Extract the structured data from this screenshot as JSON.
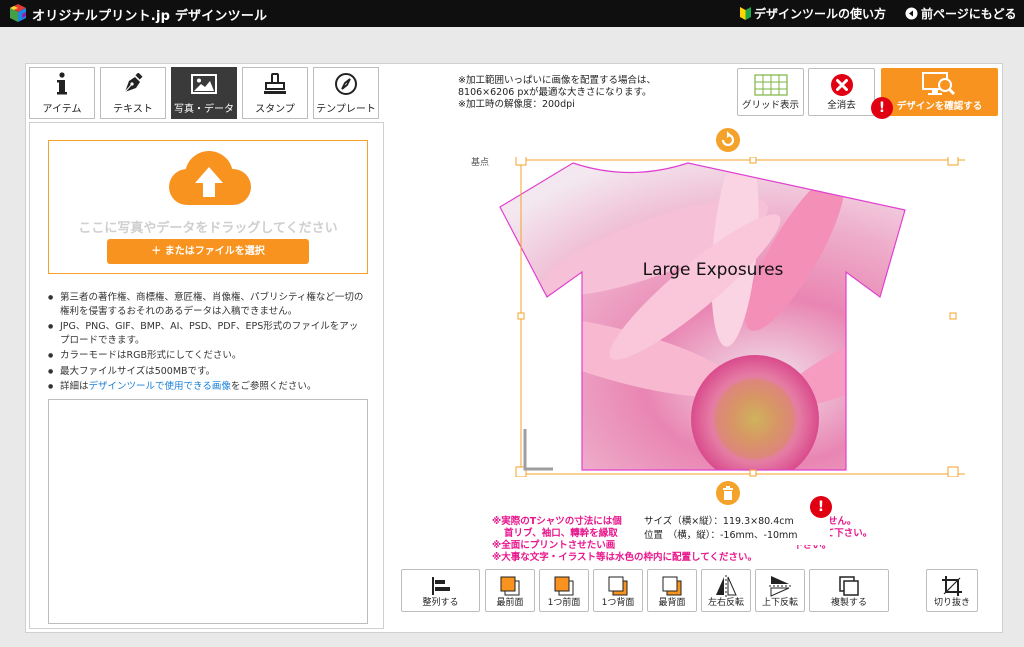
{
  "header": {
    "brand": "オリジナルプリント.jp デザインツール",
    "help_link": "デザインツールの使い方",
    "back_link": "前ページにもどる"
  },
  "tabs": [
    {
      "label": "アイテム",
      "icon": "info-icon"
    },
    {
      "label": "テキスト",
      "icon": "pen-icon"
    },
    {
      "label": "写真・データ",
      "icon": "image-icon",
      "active": true
    },
    {
      "label": "スタンプ",
      "icon": "stamp-icon"
    },
    {
      "label": "テンプレート",
      "icon": "compass-icon"
    }
  ],
  "upload": {
    "drop_text": "ここに写真やデータをドラッグしてください",
    "file_button": "＋ またはファイルを選択"
  },
  "notes": {
    "n1": "第三者の著作権、商標権、意匠権、肖像権、パブリシティ権など一切の権利を侵害するおそれのあるデータは入稿できません。",
    "n2": "JPG、PNG、GIF、BMP、AI、PSD、PDF、EPS形式のファイルをアップロードできます。",
    "n3": "カラーモードはRGB形式にしてください。",
    "n4": "最大ファイルサイズは500MBです。",
    "n5_prefix": "詳細は",
    "n5_link": "デザインツールで使用できる画像",
    "n5_suffix": "をご参照ください。"
  },
  "canvas_note": {
    "line1": "※加工範囲いっぱいに画像を配置する場合は、",
    "line2": "8106×6206 pxが最適な大きさになります。",
    "line3": "※加工時の解像度：200dpi"
  },
  "toolbar": {
    "grid_label": "グリッド表示",
    "clear_label": "全消去",
    "confirm_label": "デザインを確認する"
  },
  "design": {
    "base_label": "基点",
    "text": "Large Exposures"
  },
  "warnings": {
    "w1": "※実際のTシャツの寸法には個",
    "w1b": "出来ません。",
    "w2": "首リブ、袖口、轉幹を縁取",
    "w2b": "避けて下さい。",
    "w3": "※全面にプリントさせたい画",
    "w3b": "下さい。",
    "w4": "※大事な文字・イラスト等は水色の枠内に配置してください。"
  },
  "info": {
    "size": "サイズ（横×縦）：119.3×80.4cm",
    "position": "位置　（横，縦）：-16mm、-10mm"
  },
  "bottom_tools": [
    {
      "label": "整列する",
      "icon": "align-icon"
    },
    {
      "label": "最前面",
      "icon": "bring-front-icon"
    },
    {
      "label": "1つ前面",
      "icon": "bring-forward-icon"
    },
    {
      "label": "1つ背面",
      "icon": "send-backward-icon"
    },
    {
      "label": "最背面",
      "icon": "send-back-icon"
    },
    {
      "label": "左右反転",
      "icon": "flip-horizontal-icon"
    },
    {
      "label": "上下反転",
      "icon": "flip-vertical-icon"
    },
    {
      "label": "複製する",
      "icon": "duplicate-icon"
    },
    {
      "label": "切り抜き",
      "icon": "crop-icon"
    }
  ],
  "colors": {
    "accent": "#f7931e",
    "alert": "#e00012",
    "warning_text": "#e8168c"
  }
}
